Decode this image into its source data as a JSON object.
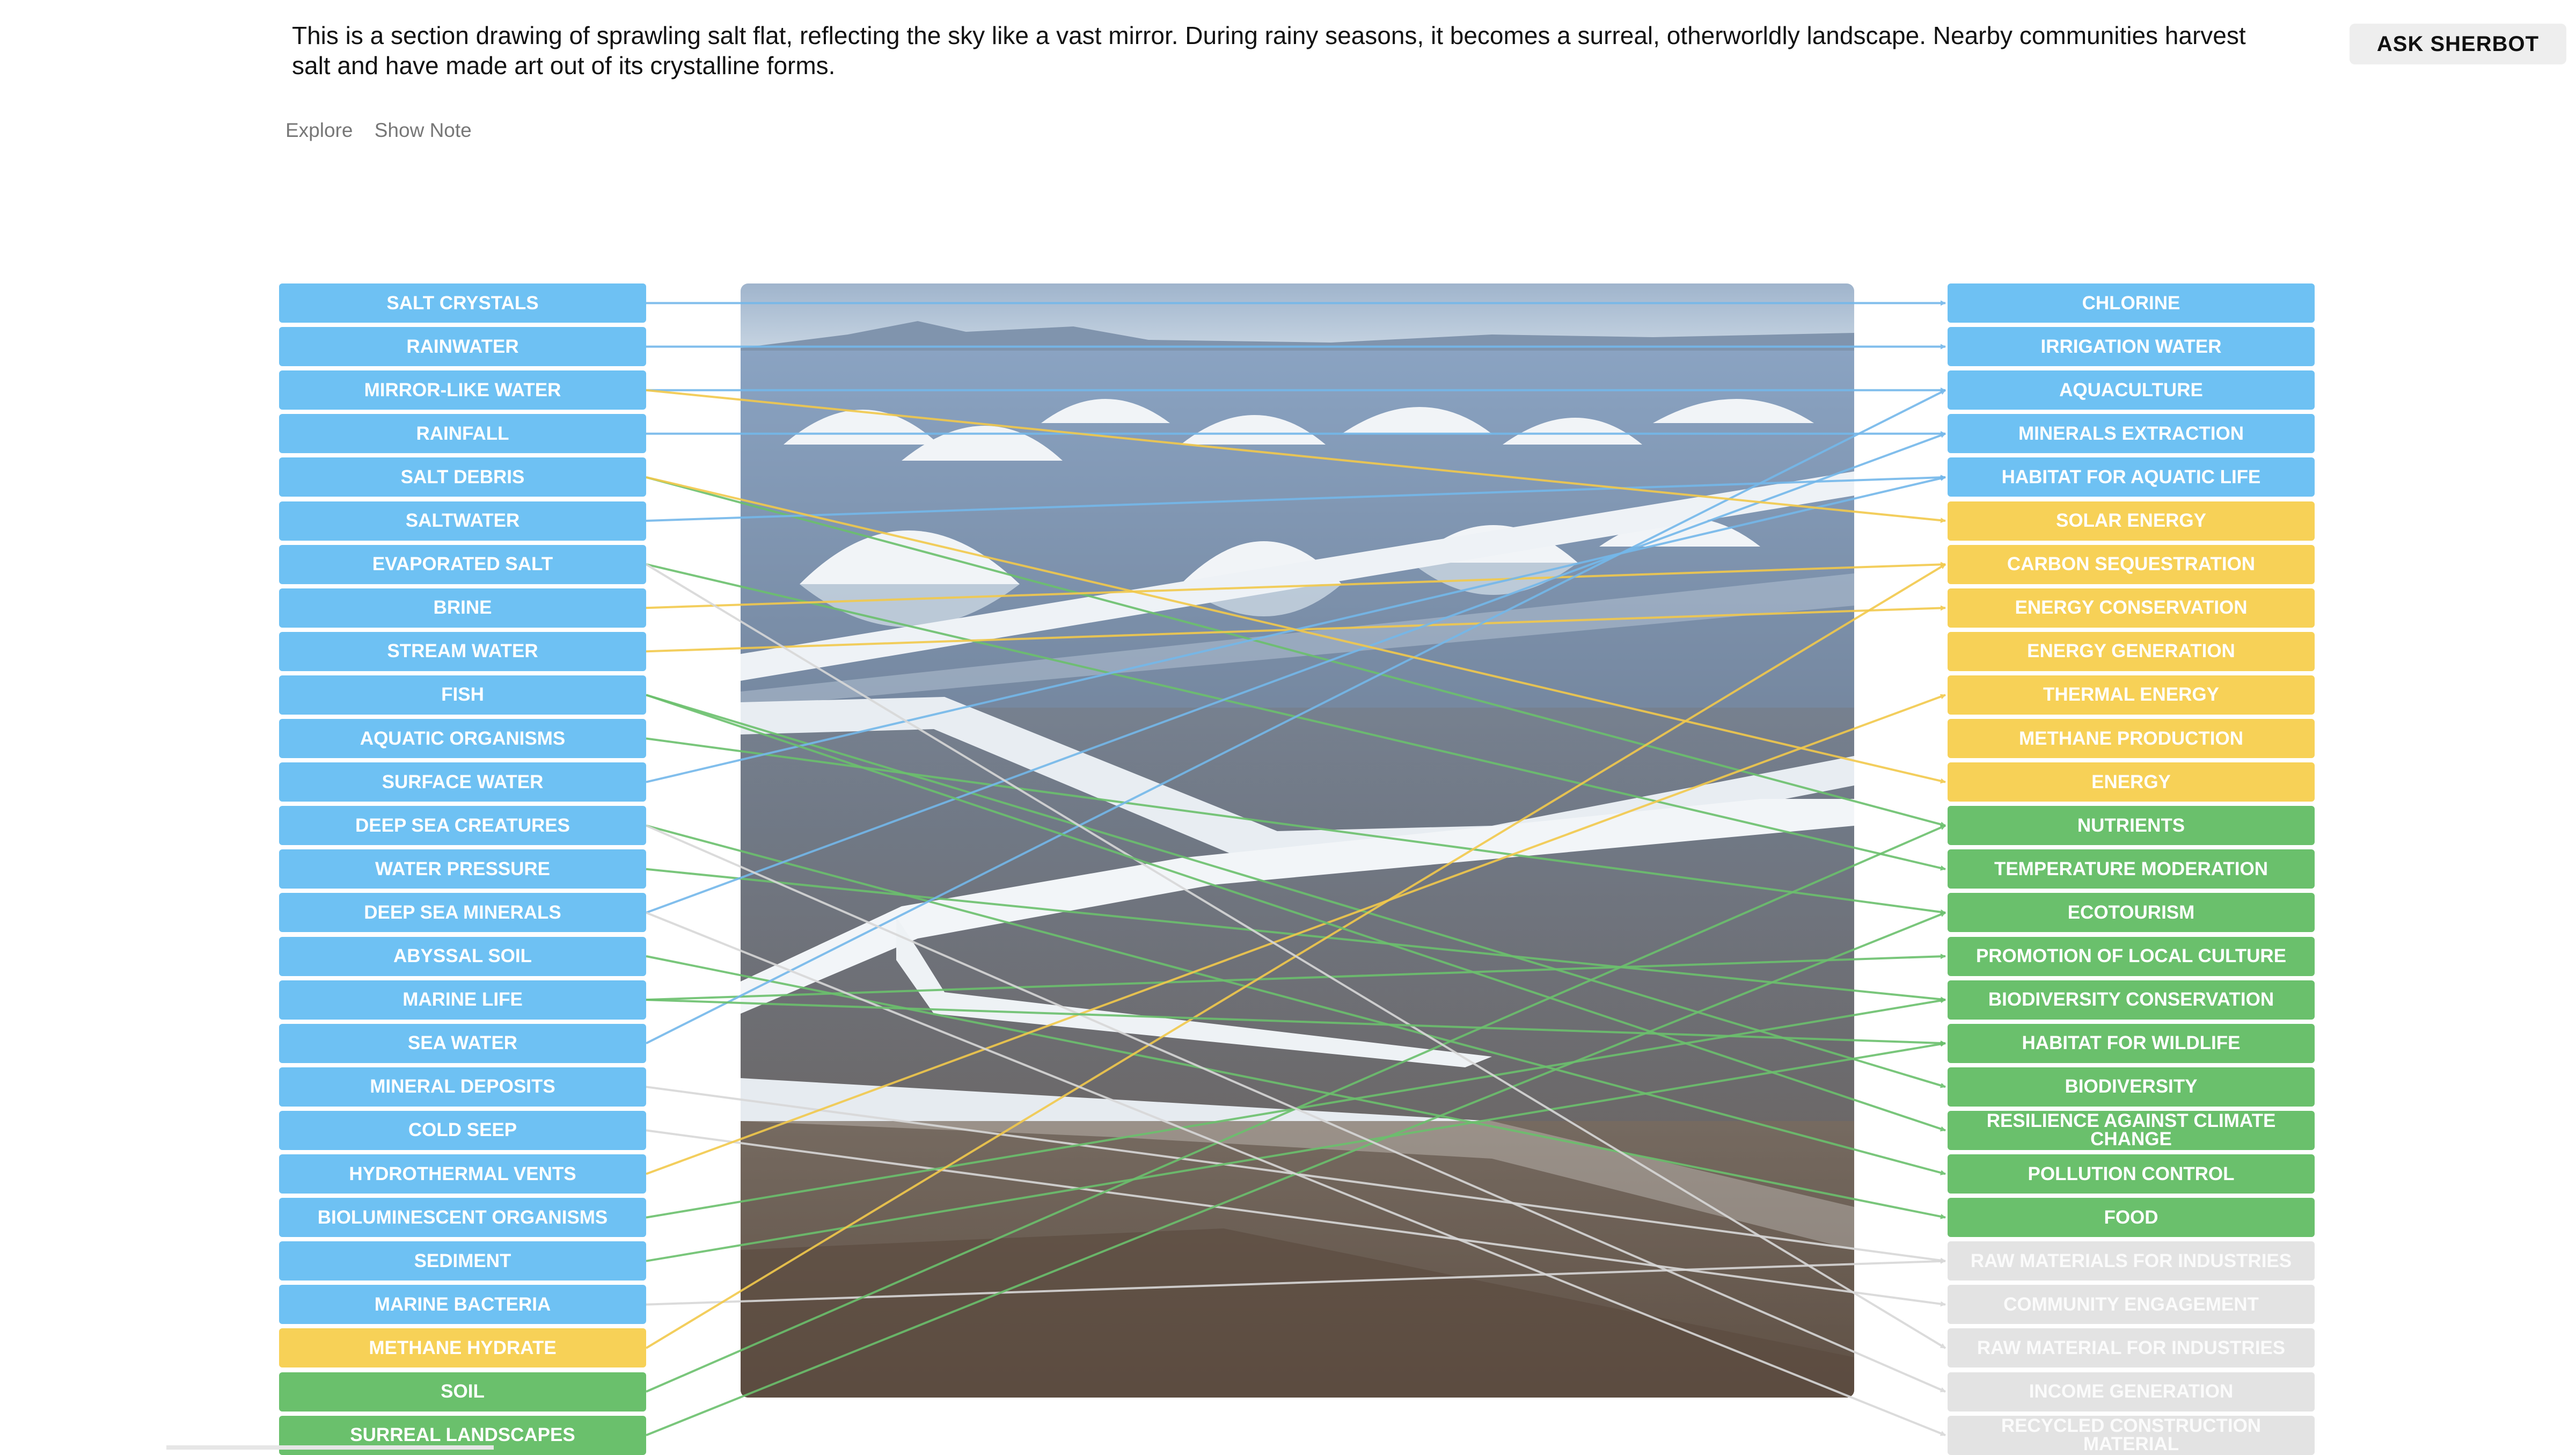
{
  "description": "This is a section drawing of sprawling salt flat, reflecting the sky like a vast mirror. During rainy seasons, it becomes a surreal, otherworldly landscape. Nearby communities harvest salt and have made art out of its crystalline forms.",
  "ask_button": "ASK SHERBOT",
  "links": {
    "explore": "Explore",
    "show_note": "Show Note"
  },
  "colors": {
    "blue": "#6ec1f3",
    "yellow": "#f7d157",
    "green": "#6ac06c",
    "gray": "#e3e3e3"
  },
  "left_items": [
    {
      "label": "SALT CRYSTALS",
      "color": "blue"
    },
    {
      "label": "RAINWATER",
      "color": "blue"
    },
    {
      "label": "MIRROR-LIKE WATER",
      "color": "blue"
    },
    {
      "label": "RAINFALL",
      "color": "blue"
    },
    {
      "label": "SALT DEBRIS",
      "color": "blue"
    },
    {
      "label": "SALTWATER",
      "color": "blue"
    },
    {
      "label": "EVAPORATED SALT",
      "color": "blue"
    },
    {
      "label": "BRINE",
      "color": "blue"
    },
    {
      "label": "STREAM WATER",
      "color": "blue"
    },
    {
      "label": "FISH",
      "color": "blue"
    },
    {
      "label": "AQUATIC ORGANISMS",
      "color": "blue"
    },
    {
      "label": "SURFACE WATER",
      "color": "blue"
    },
    {
      "label": "DEEP SEA CREATURES",
      "color": "blue"
    },
    {
      "label": "WATER PRESSURE",
      "color": "blue"
    },
    {
      "label": "DEEP SEA MINERALS",
      "color": "blue"
    },
    {
      "label": "ABYSSAL SOIL",
      "color": "blue"
    },
    {
      "label": "MARINE LIFE",
      "color": "blue"
    },
    {
      "label": "SEA WATER",
      "color": "blue"
    },
    {
      "label": "MINERAL DEPOSITS",
      "color": "blue"
    },
    {
      "label": "COLD SEEP",
      "color": "blue"
    },
    {
      "label": "HYDROTHERMAL VENTS",
      "color": "blue"
    },
    {
      "label": "BIOLUMINESCENT ORGANISMS",
      "color": "blue"
    },
    {
      "label": "SEDIMENT",
      "color": "blue"
    },
    {
      "label": "MARINE BACTERIA",
      "color": "blue"
    },
    {
      "label": "METHANE HYDRATE",
      "color": "yellow"
    },
    {
      "label": "SOIL",
      "color": "green"
    },
    {
      "label": "SURREAL LANDSCAPES",
      "color": "green"
    }
  ],
  "right_items": [
    {
      "label": "CHLORINE",
      "color": "blue"
    },
    {
      "label": "IRRIGATION WATER",
      "color": "blue"
    },
    {
      "label": "AQUACULTURE",
      "color": "blue"
    },
    {
      "label": "MINERALS EXTRACTION",
      "color": "blue"
    },
    {
      "label": "HABITAT FOR AQUATIC LIFE",
      "color": "blue"
    },
    {
      "label": "SOLAR ENERGY",
      "color": "yellow"
    },
    {
      "label": "CARBON SEQUESTRATION",
      "color": "yellow"
    },
    {
      "label": "ENERGY CONSERVATION",
      "color": "yellow"
    },
    {
      "label": "ENERGY GENERATION",
      "color": "yellow"
    },
    {
      "label": "THERMAL ENERGY",
      "color": "yellow"
    },
    {
      "label": "METHANE PRODUCTION",
      "color": "yellow"
    },
    {
      "label": "ENERGY",
      "color": "yellow"
    },
    {
      "label": "NUTRIENTS",
      "color": "green"
    },
    {
      "label": "TEMPERATURE MODERATION",
      "color": "green"
    },
    {
      "label": "ECOTOURISM",
      "color": "green"
    },
    {
      "label": "PROMOTION OF LOCAL CULTURE",
      "color": "green"
    },
    {
      "label": "BIODIVERSITY CONSERVATION",
      "color": "green"
    },
    {
      "label": "HABITAT FOR WILDLIFE",
      "color": "green"
    },
    {
      "label": "BIODIVERSITY",
      "color": "green"
    },
    {
      "label": "RESILIENCE AGAINST CLIMATE CHANGE",
      "color": "green"
    },
    {
      "label": "POLLUTION CONTROL",
      "color": "green"
    },
    {
      "label": "FOOD",
      "color": "green"
    },
    {
      "label": "RAW MATERIALS FOR INDUSTRIES",
      "color": "gray"
    },
    {
      "label": "COMMUNITY ENGAGEMENT",
      "color": "gray"
    },
    {
      "label": "RAW MATERIAL FOR INDUSTRIES",
      "color": "gray"
    },
    {
      "label": "INCOME GENERATION",
      "color": "gray"
    },
    {
      "label": "RECYCLED CONSTRUCTION MATERIAL",
      "color": "gray"
    }
  ],
  "connections": [
    [
      0,
      0
    ],
    [
      1,
      1
    ],
    [
      2,
      2
    ],
    [
      3,
      3
    ],
    [
      4,
      12
    ],
    [
      5,
      4
    ],
    [
      6,
      13
    ],
    [
      7,
      6
    ],
    [
      8,
      7
    ],
    [
      9,
      18
    ],
    [
      10,
      14
    ],
    [
      11,
      4
    ],
    [
      12,
      20
    ],
    [
      13,
      16
    ],
    [
      14,
      3
    ],
    [
      15,
      21
    ],
    [
      16,
      15
    ],
    [
      17,
      2
    ],
    [
      18,
      22
    ],
    [
      19,
      23
    ],
    [
      20,
      9
    ],
    [
      21,
      16
    ],
    [
      22,
      17
    ],
    [
      23,
      22
    ],
    [
      24,
      6
    ],
    [
      25,
      12
    ],
    [
      26,
      14
    ],
    [
      2,
      5
    ],
    [
      4,
      11
    ],
    [
      6,
      24
    ],
    [
      9,
      19
    ],
    [
      12,
      25
    ],
    [
      14,
      26
    ],
    [
      16,
      17
    ]
  ]
}
